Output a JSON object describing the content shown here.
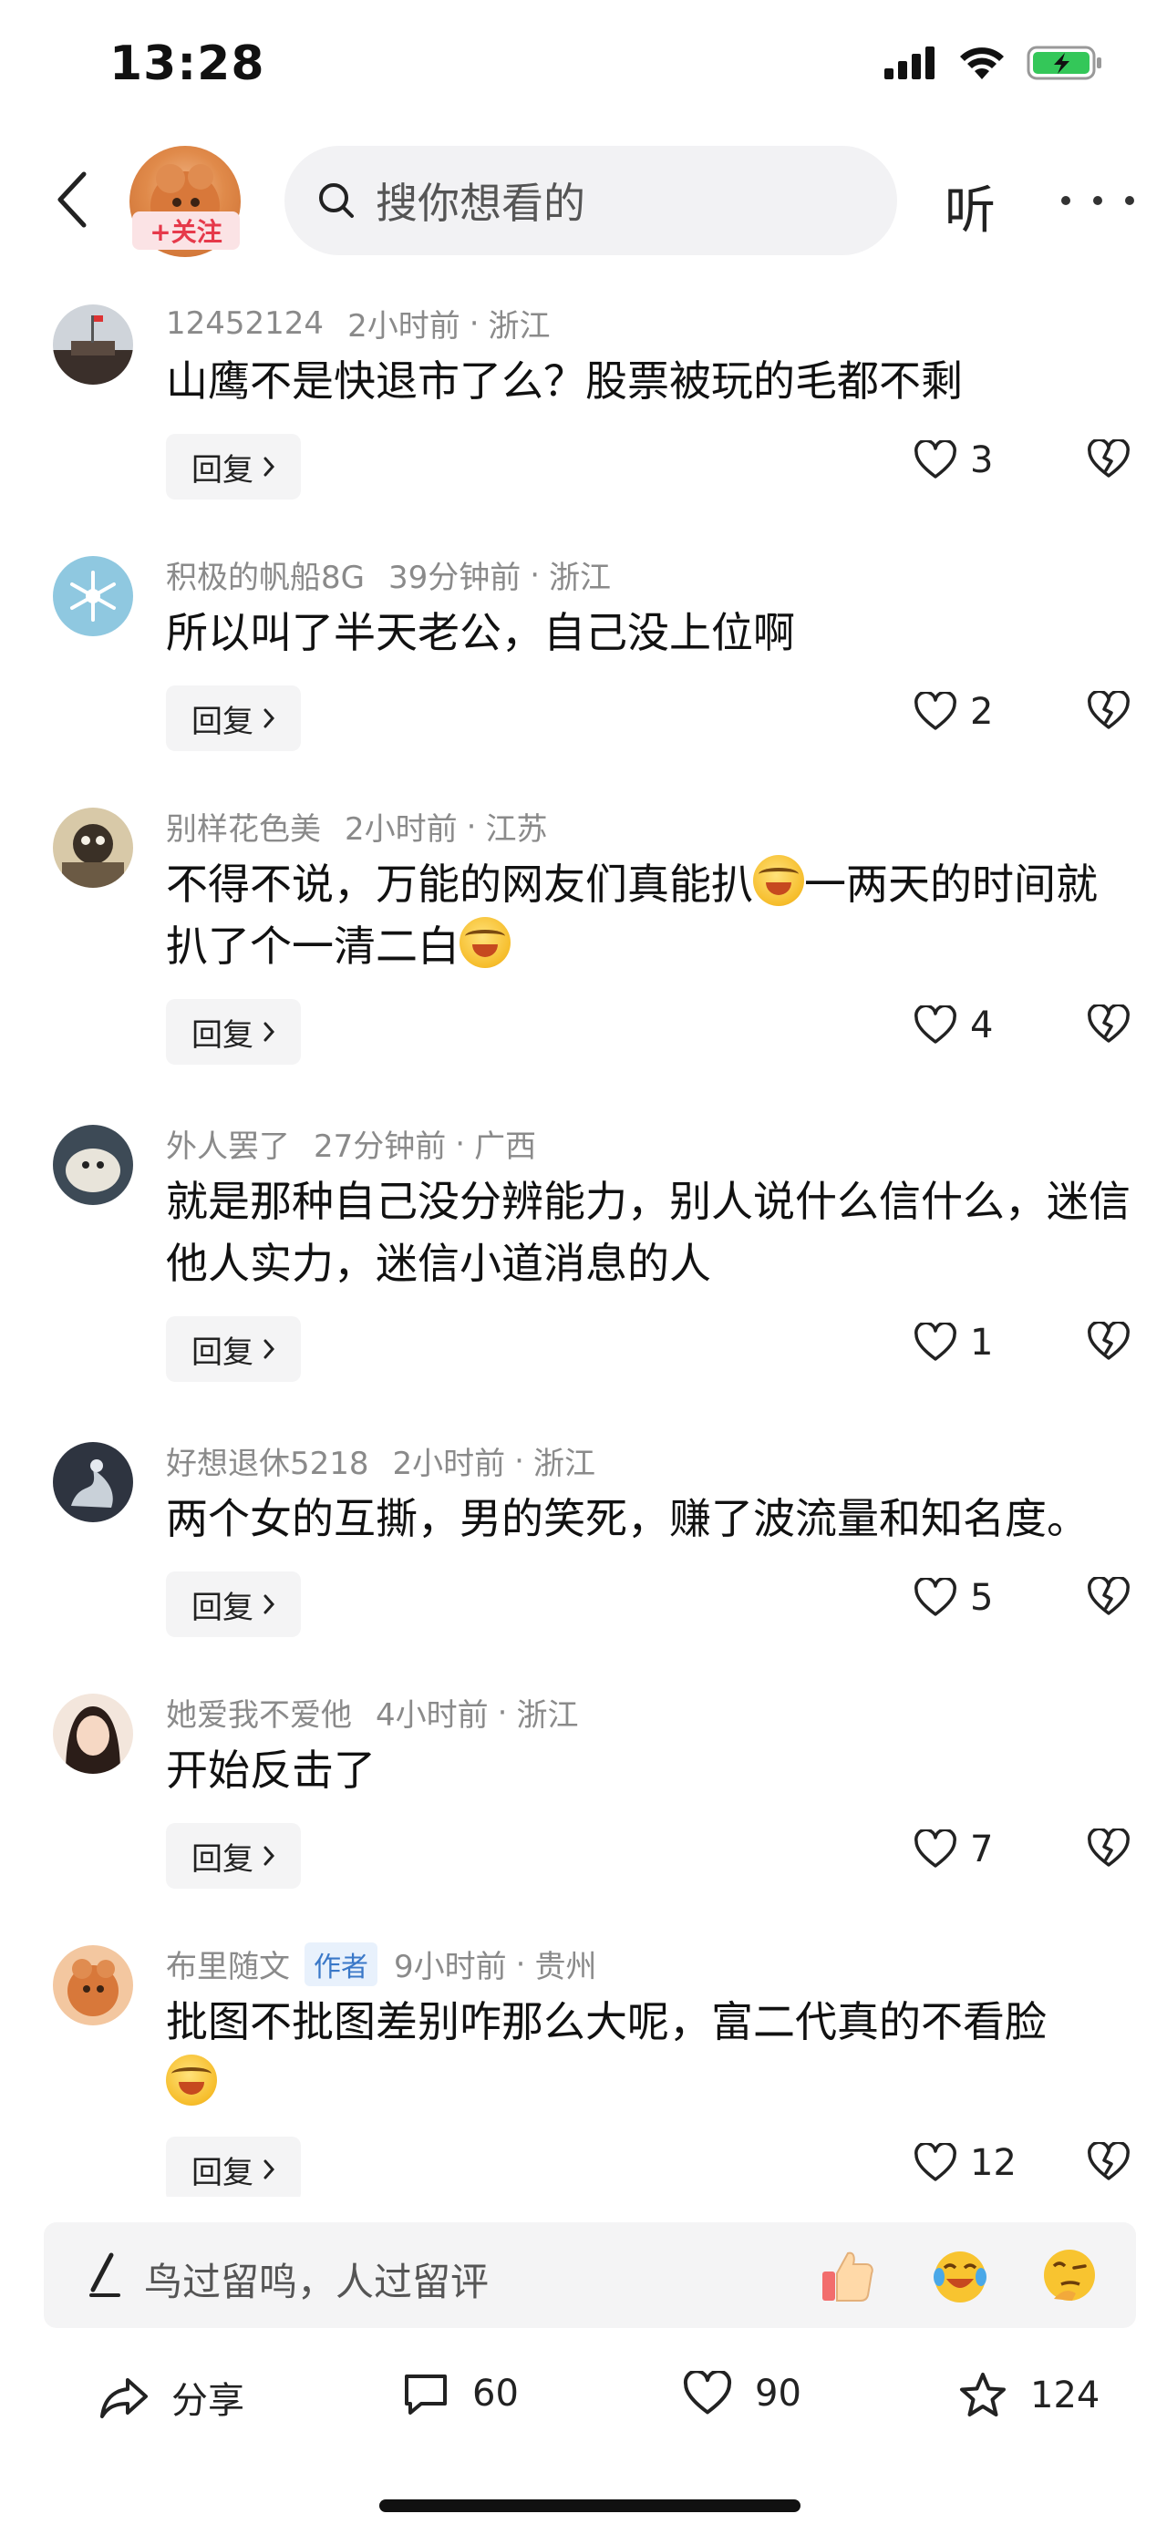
{
  "status": {
    "time": "13:28"
  },
  "nav": {
    "follow_label": "+关注",
    "search_placeholder": "搜你想看的",
    "listen_label": "听"
  },
  "comments": [
    {
      "user": "12452124",
      "time": "2小时前",
      "location": "浙江",
      "text": "山鹰不是快退市了么？股票被玩的毛都不剩",
      "likes": "3",
      "reply_label": "回复",
      "author_tag": ""
    },
    {
      "user": "积极的帆船8G",
      "time": "39分钟前",
      "location": "浙江",
      "text": "所以叫了半天老公，自己没上位啊",
      "likes": "2",
      "reply_label": "回复",
      "author_tag": ""
    },
    {
      "user": "别样花色美",
      "time": "2小时前",
      "location": "江苏",
      "text_a": "不得不说，万能的网友们真能扒",
      "text_b": "一两天的时间就扒了个一清二白",
      "likes": "4",
      "reply_label": "回复",
      "author_tag": ""
    },
    {
      "user": "外人罢了",
      "time": "27分钟前",
      "location": "广西",
      "text": "就是那种自己没分辨能力，别人说什么信什么，迷信他人实力，迷信小道消息的人",
      "likes": "1",
      "reply_label": "回复",
      "author_tag": ""
    },
    {
      "user": "好想退休5218",
      "time": "2小时前",
      "location": "浙江",
      "text": "两个女的互撕，男的笑死，赚了波流量和知名度。",
      "likes": "5",
      "reply_label": "回复",
      "author_tag": ""
    },
    {
      "user": "她爱我不爱他",
      "time": "4小时前",
      "location": "浙江",
      "text": "开始反击了",
      "likes": "7",
      "reply_label": "回复",
      "author_tag": ""
    },
    {
      "user": "布里随文",
      "time": "9小时前",
      "location": "贵州",
      "text": "批图不批图差别咋那么大呢，富二代真的不看脸",
      "likes": "12",
      "reply_label": "回复",
      "author_tag": "作者"
    }
  ],
  "input_bar": {
    "placeholder": "鸟过留鸣，人过留评"
  },
  "bottom_bar": {
    "share_label": "分享",
    "comment_count": "60",
    "like_count": "90",
    "favorite_count": "124"
  },
  "colors": {
    "follow_red": "#e6394a",
    "author_tag_blue": "#3a78c8",
    "meta_gray": "#8a8a8a",
    "battery_green": "#34c759"
  },
  "icons": [
    "back-icon",
    "search-icon",
    "more-icon",
    "chevron-right-icon",
    "heart-icon",
    "broken-heart-icon",
    "pen-icon",
    "share-icon",
    "comment-icon",
    "star-icon",
    "signal-icon",
    "wifi-icon",
    "battery-icon"
  ]
}
